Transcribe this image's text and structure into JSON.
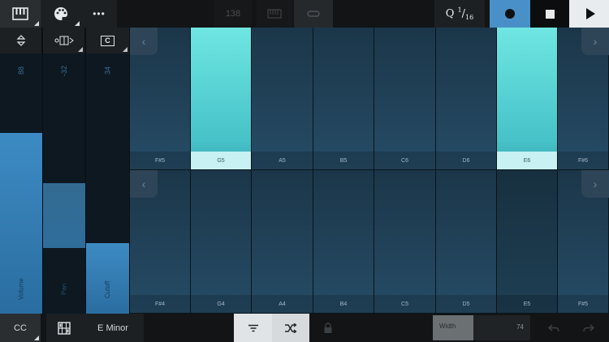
{
  "top_bar": {
    "keyboard_icon": "piano-icon",
    "palette_icon": "palette-icon",
    "more_label": "•••",
    "tempo": "138",
    "metronome_icon": "metronome-icon",
    "loop_icon": "loop-icon",
    "quantize": {
      "letter": "Q",
      "num": "1",
      "den": "16"
    },
    "record_icon": "record-icon",
    "stop_icon": "stop-icon",
    "play_icon": "play-icon",
    "accent": "#4a90c8"
  },
  "cc_strip": {
    "headers": [
      {
        "icon": "up-down-arrows-icon"
      },
      {
        "icon": "range-icon"
      },
      {
        "label": "C"
      }
    ],
    "faders": [
      {
        "name": "Volume",
        "value": "88",
        "level": 0.69
      },
      {
        "name": "Pan",
        "value": "-32",
        "level": 0.25
      },
      {
        "name": "Cutoff",
        "value": "34",
        "level": 0.27
      }
    ]
  },
  "pads": {
    "top_row": [
      {
        "note": "F#5",
        "lit": false
      },
      {
        "note": "G5",
        "lit": true
      },
      {
        "note": "A5",
        "lit": false
      },
      {
        "note": "B5",
        "lit": false
      },
      {
        "note": "C6",
        "lit": false
      },
      {
        "note": "D6",
        "lit": false
      },
      {
        "note": "E6",
        "lit": true
      },
      {
        "note": "F#6",
        "lit": false
      }
    ],
    "bottom_row": [
      {
        "note": "F#4",
        "lit": false
      },
      {
        "note": "G4",
        "lit": false
      },
      {
        "note": "A4",
        "lit": false
      },
      {
        "note": "B4",
        "lit": false
      },
      {
        "note": "C5",
        "lit": false
      },
      {
        "note": "D5",
        "lit": false
      },
      {
        "note": "E5",
        "lit": false
      },
      {
        "note": "F#5",
        "lit": false
      }
    ],
    "prev_arrow": "‹",
    "next_arrow": "›"
  },
  "bottom_bar": {
    "cc_label": "CC",
    "layout_icon": "grid-layout-icon",
    "scale": "E Minor",
    "filter_icon": "filter-icon",
    "shuffle_icon": "shuffle-icon",
    "lock_icon": "lock-icon",
    "width_label": "Width",
    "width_value": "74",
    "width_level": 0.42,
    "undo_icon": "undo-icon",
    "redo_icon": "redo-icon"
  }
}
